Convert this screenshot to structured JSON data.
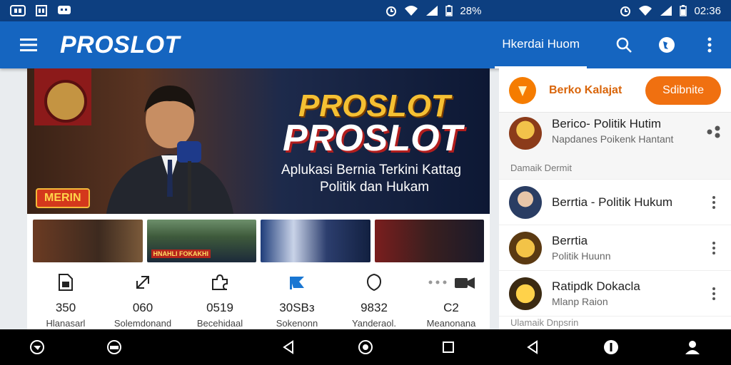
{
  "status_bar": {
    "battery": "28%",
    "time": "02:36",
    "icons": [
      "cast-icon",
      "gallery-icon",
      "message-icon",
      "alarm-icon",
      "wifi-icon",
      "signal-icon",
      "battery-icon"
    ]
  },
  "app_bar": {
    "title": "PROSLOT",
    "active_tab": "Hkerdai Huom",
    "icons": [
      "menu-icon",
      "search-icon",
      "globe-icon",
      "more-icon"
    ]
  },
  "hero": {
    "badge": "MERIN",
    "logo_top": "PROSLOT",
    "logo_main": "PROSLOT",
    "tagline_1": "Aplukasi Bernia Terkini Kattag",
    "tagline_2": "Politik dan Hukam"
  },
  "thumbnails": [
    {
      "label": ""
    },
    {
      "label": "HNAHLI FOKAKHI"
    },
    {
      "label": ""
    },
    {
      "label": ""
    }
  ],
  "stats": [
    {
      "icon": "document-icon",
      "value": "350",
      "label": "Hlanasarl"
    },
    {
      "icon": "expand-icon",
      "value": "060",
      "label": "Solemdonand"
    },
    {
      "icon": "puzzle-icon",
      "value": "0519",
      "label": "Becehidaal"
    },
    {
      "icon": "flag-icon",
      "value": "30SBз",
      "label": "Sokenonn"
    },
    {
      "icon": "shield-icon",
      "value": "9832",
      "label": "Yanderaol."
    },
    {
      "icon": "video-icon",
      "value": "C2",
      "label": "Meanonana"
    }
  ],
  "side": {
    "title": "Berko Kalajat",
    "subscribe": "Sdibnite",
    "items": [
      {
        "title": "Berico- Politik Hutim",
        "subtitle": "Napdanes Poikenk Hantant",
        "date": "Damaik Dermit"
      },
      {
        "title": "Berrtia - Politik Hukum",
        "subtitle": ""
      },
      {
        "title": "Berrtia",
        "subtitle": "Politik Huunn"
      },
      {
        "title": "Ratipdk Dokacla",
        "subtitle": "Mlanp Raion"
      }
    ],
    "footer": "Ulamaik Dnpsrin"
  },
  "colors": {
    "status_bar": "#0d3f80",
    "app_bar": "#1565c0",
    "accent": "#f07010",
    "nav_bar": "#000000"
  },
  "nav_bar": {
    "icons": [
      "app-icon",
      "photos-icon",
      "back-icon",
      "home-icon",
      "recents-icon",
      "back-icon",
      "info-icon",
      "contact-icon"
    ]
  }
}
